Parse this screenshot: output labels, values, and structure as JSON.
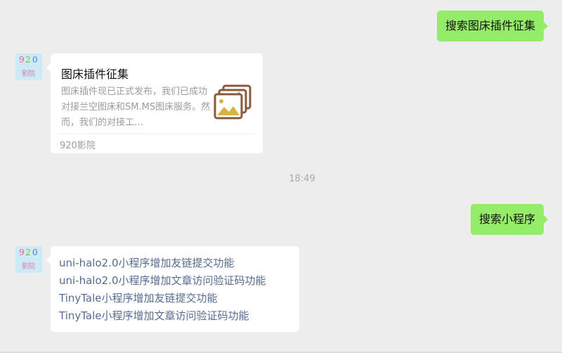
{
  "messages": {
    "out1": {
      "text": "搜索图床插件征集"
    },
    "card": {
      "title": "图床插件征集",
      "description": "图床插件现已正式发布，我们已成功对接兰空图床和SM.MS图床服务。然而，我们的对接工…",
      "source": "920影院",
      "thumbnail_icon": "image-gallery-icon"
    },
    "timestamp": "18:49",
    "out2": {
      "text": "搜索小程序"
    },
    "links": [
      "uni-halo2.0小程序增加友链提交功能",
      "uni-halo2.0小程序增加文章访问验证码功能",
      "TinyTale小程序增加友链提交功能",
      "TinyTale小程序增加文章访问验证码功能"
    ]
  },
  "avatar": {
    "digits": [
      "9",
      "2",
      "0"
    ],
    "label": "影院"
  },
  "colors": {
    "background": "#ededed",
    "outgoing_bubble": "#95ec69",
    "incoming_bubble": "#ffffff",
    "link": "#576b95",
    "muted_text": "#9b9b9b"
  }
}
